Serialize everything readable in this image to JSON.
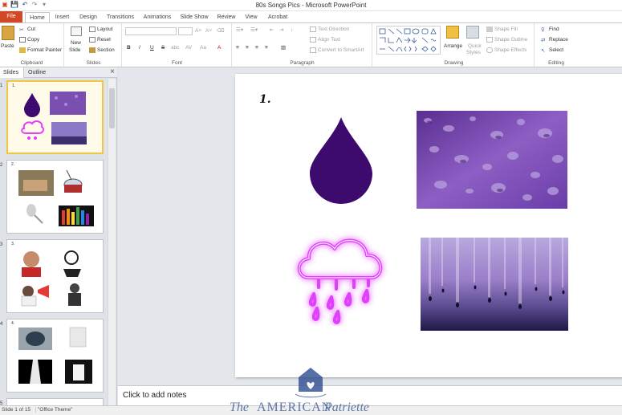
{
  "window": {
    "title": "80s Songs Pics - Microsoft PowerPoint"
  },
  "tabs": [
    "File",
    "Home",
    "Insert",
    "Design",
    "Transitions",
    "Animations",
    "Slide Show",
    "Review",
    "View",
    "Acrobat"
  ],
  "ribbon": {
    "clipboard": {
      "paste": "Paste",
      "cut": "Cut",
      "copy": "Copy",
      "format_painter": "Format Painter",
      "label": "Clipboard"
    },
    "slides": {
      "new_slide_1": "New",
      "new_slide_2": "Slide",
      "layout": "Layout",
      "reset": "Reset",
      "section": "Section",
      "label": "Slides"
    },
    "font": {
      "bold": "B",
      "italic": "I",
      "underline": "U",
      "strike": "S",
      "shadow": "abc",
      "spacing": "AV",
      "case": "Aa",
      "color": "A",
      "label": "Font"
    },
    "paragraph": {
      "text_direction": "Text Direction",
      "align_text": "Align Text",
      "convert_smartart": "Convert to SmartArt",
      "label": "Paragraph"
    },
    "drawing": {
      "arrange": "Arrange",
      "quick_styles_1": "Quick",
      "quick_styles_2": "Styles",
      "shape_fill": "Shape Fill",
      "shape_outline": "Shape Outline",
      "shape_effects": "Shape Effects",
      "label": "Drawing"
    },
    "editing": {
      "find": "Find",
      "replace": "Replace",
      "select": "Select",
      "label": "Editing"
    }
  },
  "pane": {
    "tab_slides": "Slides",
    "tab_outline": "Outline",
    "close": "×",
    "thumbnails": [
      {
        "number": "1",
        "label": "1."
      },
      {
        "number": "2",
        "label": "2."
      },
      {
        "number": "3",
        "label": "3."
      },
      {
        "number": "4",
        "label": "4."
      },
      {
        "number": "5",
        "label": ""
      }
    ]
  },
  "slide": {
    "number_label": "1."
  },
  "notes": {
    "placeholder": "Click to add notes"
  },
  "status": {
    "slide_info": "Slide 1 of 15",
    "theme": "\"Office Theme\""
  },
  "watermark": {
    "text_1": "The",
    "text_2": "AMERICAN",
    "text_3": "Patriette"
  },
  "colors": {
    "accent": "#2b579a",
    "file_tab": "#d24726",
    "drop": "#3d0a6e",
    "neon": "#e040fb"
  }
}
